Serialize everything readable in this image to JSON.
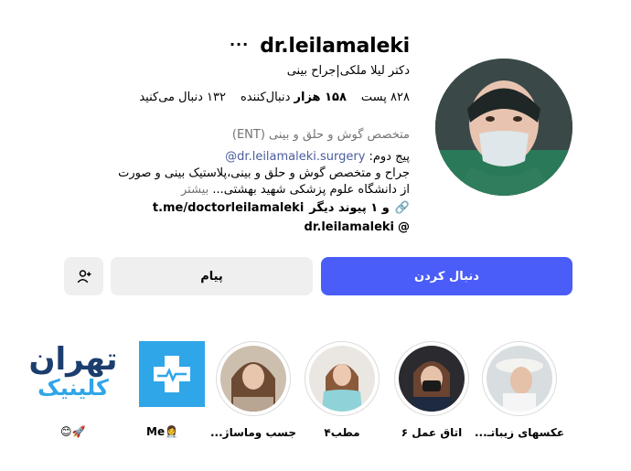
{
  "profile": {
    "username": "dr.leilamaleki",
    "more_icon": "more-horizontal-icon",
    "full_name": "دکتر لیلا ملکی|جراح بینی",
    "stats": {
      "posts": "۸۲۸ پست",
      "followers_count": "۱۵۸ هزار",
      "followers_label": "دنبال‌کننده",
      "following": "۱۳۲ دنبال می‌کنید"
    },
    "category": "متخصص گوش و حلق و بینی (ENT)",
    "thread_tag_prefix": "پیج دوم:",
    "thread_tag_link": "@dr.leilamaleki.surgery",
    "bio_lines": [
      "جراح و متخصص گوش و حلق و بینی،پلاستیک بینی و صورت",
      "از دانشگاه علوم پزشکی شهید بهشتی...",
      "بیشتر"
    ],
    "link_text": "t.me/doctorleilamaleki",
    "link_more": "و ۱ پیوند دیگر",
    "threads_handle": "dr.leilamaleki"
  },
  "actions": {
    "follow": "دنبال کردن",
    "message": "پیام",
    "suggest_icon": "add-person-icon"
  },
  "highlights": [
    {
      "label": "عکسهای زیباتـ..."
    },
    {
      "label": "اتاق عمل ۶"
    },
    {
      "label": "مطب۴"
    },
    {
      "label": "جسب وماساژ..."
    },
    {
      "label": "Me👩‍⚕️"
    },
    {
      "label": "😊🚀"
    }
  ],
  "logo": {
    "line1": "تهران",
    "line2": "کلینیک",
    "accent": "#2fa6e8",
    "dark": "#1c3e6e"
  },
  "colors": {
    "follow_bg": "#4a5df9",
    "button_bg": "#efefef",
    "muted": "#737373",
    "link": "#4a5d9e"
  }
}
